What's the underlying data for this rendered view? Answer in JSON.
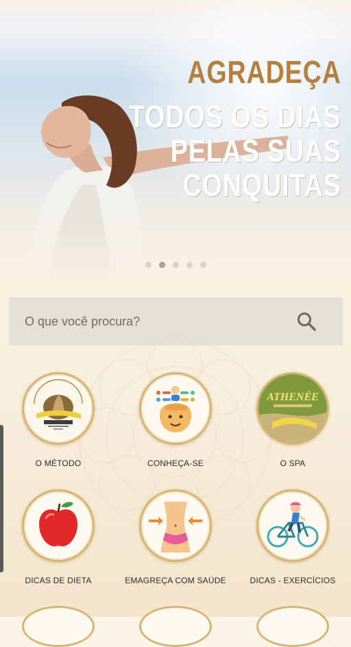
{
  "banner": {
    "headline_line1": "AGRADEÇA",
    "headline_line2": "TODOS OS DIAS",
    "headline_line3": "PELAS SUAS",
    "headline_line4": "CONQUITAS",
    "slides_total": 5,
    "active_slide": 2
  },
  "search": {
    "placeholder": "O que você procura?",
    "icon": "search-icon"
  },
  "menu": {
    "items": [
      {
        "label": "O MÉTODO",
        "icon": "athenee-logo-icon"
      },
      {
        "label": "CONHEÇA-SE",
        "icon": "head-mind-icon"
      },
      {
        "label": "O SPA",
        "icon": "spa-logo-icon"
      },
      {
        "label": "DICAS DE DIETA",
        "icon": "apple-icon"
      },
      {
        "label": "EMAGREÇA COM SAÚDE",
        "icon": "waist-slim-icon"
      },
      {
        "label": "DICAS - EXERCÍCIOS",
        "icon": "cyclist-icon"
      }
    ]
  },
  "colors": {
    "accent_gold": "#b57f3f",
    "ring_gold": "#d7b571",
    "background": "#fbf4e8"
  }
}
